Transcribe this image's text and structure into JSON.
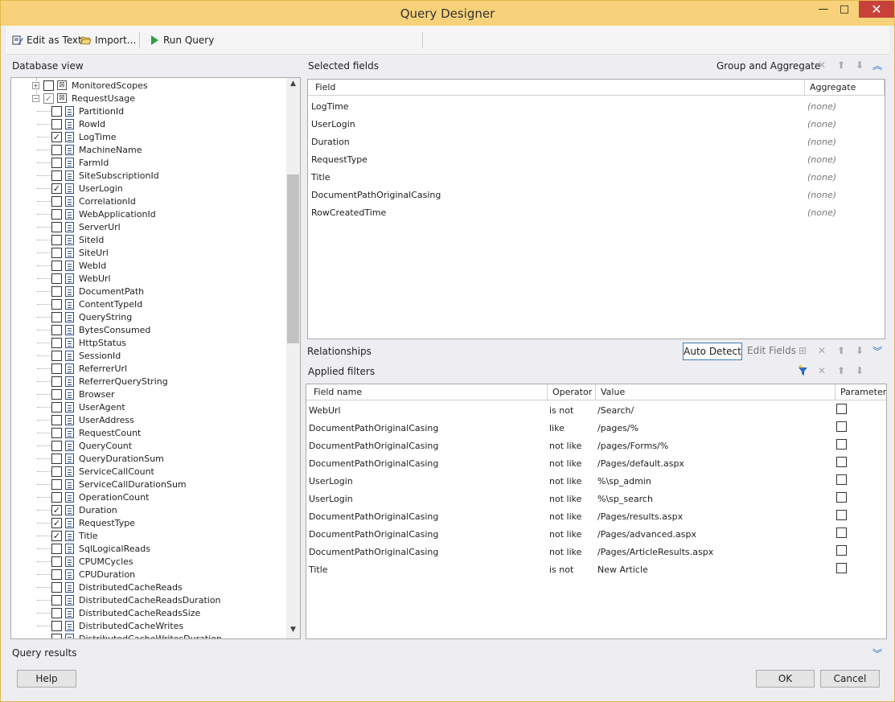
{
  "window": {
    "title": "Query Designer",
    "min_glyph": "—",
    "max_glyph": "□",
    "close_glyph": "✕"
  },
  "toolbar": {
    "edit_as_text": "Edit as Text",
    "import": "Import...",
    "run_query": "Run Query"
  },
  "database_view": {
    "label": "Database view",
    "tables": [
      {
        "name": "MonitoredScopes",
        "checked": false,
        "expanded": false
      },
      {
        "name": "RequestUsage",
        "checked": "partial",
        "expanded": true
      }
    ],
    "fields": [
      {
        "name": "PartitionId",
        "checked": false
      },
      {
        "name": "RowId",
        "checked": false
      },
      {
        "name": "LogTime",
        "checked": true
      },
      {
        "name": "MachineName",
        "checked": false
      },
      {
        "name": "FarmId",
        "checked": false
      },
      {
        "name": "SiteSubscriptionId",
        "checked": false
      },
      {
        "name": "UserLogin",
        "checked": true
      },
      {
        "name": "CorrelationId",
        "checked": false
      },
      {
        "name": "WebApplicationId",
        "checked": false
      },
      {
        "name": "ServerUrl",
        "checked": false
      },
      {
        "name": "SiteId",
        "checked": false
      },
      {
        "name": "SiteUrl",
        "checked": false
      },
      {
        "name": "WebId",
        "checked": false
      },
      {
        "name": "WebUrl",
        "checked": false
      },
      {
        "name": "DocumentPath",
        "checked": false
      },
      {
        "name": "ContentTypeId",
        "checked": false
      },
      {
        "name": "QueryString",
        "checked": false
      },
      {
        "name": "BytesConsumed",
        "checked": false
      },
      {
        "name": "HttpStatus",
        "checked": false
      },
      {
        "name": "SessionId",
        "checked": false
      },
      {
        "name": "ReferrerUrl",
        "checked": false
      },
      {
        "name": "ReferrerQueryString",
        "checked": false
      },
      {
        "name": "Browser",
        "checked": false
      },
      {
        "name": "UserAgent",
        "checked": false
      },
      {
        "name": "UserAddress",
        "checked": false
      },
      {
        "name": "RequestCount",
        "checked": false
      },
      {
        "name": "QueryCount",
        "checked": false
      },
      {
        "name": "QueryDurationSum",
        "checked": false
      },
      {
        "name": "ServiceCallCount",
        "checked": false
      },
      {
        "name": "ServiceCallDurationSum",
        "checked": false
      },
      {
        "name": "OperationCount",
        "checked": false
      },
      {
        "name": "Duration",
        "checked": true
      },
      {
        "name": "RequestType",
        "checked": true
      },
      {
        "name": "Title",
        "checked": true
      },
      {
        "name": "SqlLogicalReads",
        "checked": false
      },
      {
        "name": "CPUMCycles",
        "checked": false
      },
      {
        "name": "CPUDuration",
        "checked": false
      },
      {
        "name": "DistributedCacheReads",
        "checked": false
      },
      {
        "name": "DistributedCacheReadsDuration",
        "checked": false
      },
      {
        "name": "DistributedCacheReadsSize",
        "checked": false
      },
      {
        "name": "DistributedCacheWrites",
        "checked": false
      },
      {
        "name": "DistributedCacheWritesDuration",
        "checked": false
      }
    ]
  },
  "selected_fields": {
    "label": "Selected fields",
    "group_aggregate": "Group and Aggregate",
    "columns": {
      "field": "Field",
      "aggregate": "Aggregate"
    },
    "rows": [
      {
        "field": "LogTime",
        "aggregate": "(none)"
      },
      {
        "field": "UserLogin",
        "aggregate": "(none)"
      },
      {
        "field": "Duration",
        "aggregate": "(none)"
      },
      {
        "field": "RequestType",
        "aggregate": "(none)"
      },
      {
        "field": "Title",
        "aggregate": "(none)"
      },
      {
        "field": "DocumentPathOriginalCasing",
        "aggregate": "(none)"
      },
      {
        "field": "RowCreatedTime",
        "aggregate": "(none)"
      }
    ]
  },
  "relationships": {
    "label": "Relationships",
    "auto_detect": "Auto Detect",
    "edit_fields": "Edit Fields"
  },
  "applied_filters": {
    "label": "Applied filters",
    "columns": {
      "field_name": "Field name",
      "operator": "Operator",
      "value": "Value",
      "parameter": "Parameter"
    },
    "rows": [
      {
        "field": "WebUrl",
        "operator": "is not",
        "value": "/Search/",
        "parameter": false
      },
      {
        "field": "DocumentPathOriginalCasing",
        "operator": "like",
        "value": "/pages/%",
        "parameter": false
      },
      {
        "field": "DocumentPathOriginalCasing",
        "operator": "not like",
        "value": "/pages/Forms/%",
        "parameter": false
      },
      {
        "field": "DocumentPathOriginalCasing",
        "operator": "not like",
        "value": "/Pages/default.aspx",
        "parameter": false
      },
      {
        "field": "UserLogin",
        "operator": "not like",
        "value": "%\\sp_admin",
        "parameter": false
      },
      {
        "field": "UserLogin",
        "operator": "not like",
        "value": "%\\sp_search",
        "parameter": false
      },
      {
        "field": "DocumentPathOriginalCasing",
        "operator": "not like",
        "value": "/Pages/results.aspx",
        "parameter": false
      },
      {
        "field": "DocumentPathOriginalCasing",
        "operator": "not like",
        "value": "/Pages/advanced.aspx",
        "parameter": false
      },
      {
        "field": "DocumentPathOriginalCasing",
        "operator": "not like",
        "value": "/Pages/ArticleResults.aspx",
        "parameter": false
      },
      {
        "field": "Title",
        "operator": "is not",
        "value": "New Article",
        "parameter": false
      }
    ]
  },
  "query_results": {
    "label": "Query results"
  },
  "buttons": {
    "help": "Help",
    "ok": "OK",
    "cancel": "Cancel"
  }
}
